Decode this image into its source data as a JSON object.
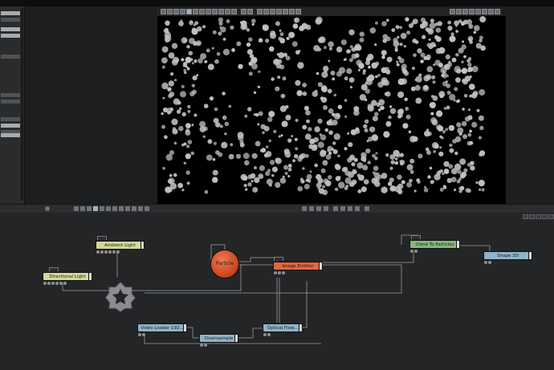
{
  "graph": {
    "nodes": {
      "ambient_light": "Ambient  Light",
      "directional_light": "Directional  Light",
      "particle": "Particle",
      "image_emitter": "Image  Emitter",
      "clone_to_particles": "Clone  To  Particles",
      "shape_3d": "Shape  3D",
      "video_loader": "Video  Loader  192...",
      "downsample": "Downsample",
      "optical_flow": "Optical  Flow..."
    }
  },
  "colors": {
    "light_node": "#d5d89a",
    "emitter_node": "#e2673e",
    "clone_node": "#84b87b",
    "shape_node": "#8fb4c8",
    "wire": "#9a9c9f",
    "viewport_background": "#000000",
    "particle_sprite": "#c2c2c2"
  },
  "icons": {
    "group": "gear-icon",
    "viewport": "particle-render-view",
    "playback": [
      "first-frame-icon",
      "step-back-icon",
      "play-reverse-icon",
      "stop-icon",
      "play-icon",
      "step-forward-icon",
      "last-frame-icon",
      "loop-icon"
    ]
  }
}
